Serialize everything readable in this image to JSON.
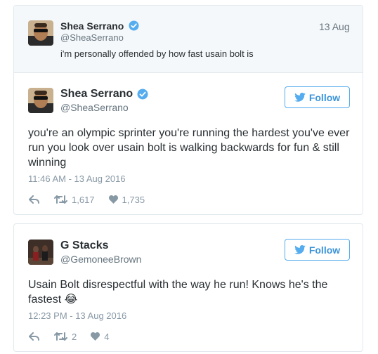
{
  "quoted_tweet": {
    "author_name": "Shea Serrano",
    "author_handle": "@SheaSerrano",
    "date": "13 Aug",
    "text": "i'm personally offended by how fast usain bolt is"
  },
  "tweets": [
    {
      "author_name": "Shea Serrano",
      "author_handle": "@SheaSerrano",
      "follow_label": "Follow",
      "text": "you're an olympic sprinter you're running the hardest you've ever run you look over usain bolt is walking backwards for fun & still winning",
      "timestamp": "11:46 AM - 13 Aug 2016",
      "retweets": "1,617",
      "likes": "1,735",
      "verified": true
    },
    {
      "author_name": "G Stacks",
      "author_handle": "@GemoneeBrown",
      "follow_label": "Follow",
      "text": "Usain Bolt disrespectful with the way he run! Knows he's the fastest",
      "emoji": "😂",
      "timestamp": "12:23 PM - 13 Aug 2016",
      "retweets": "2",
      "likes": "4",
      "verified": false
    }
  ],
  "colors": {
    "twitter_blue": "#55acee",
    "text": "#292f33",
    "muted": "#66757f",
    "timestamp": "#8899a6",
    "card_border": "#e1e8ed"
  }
}
